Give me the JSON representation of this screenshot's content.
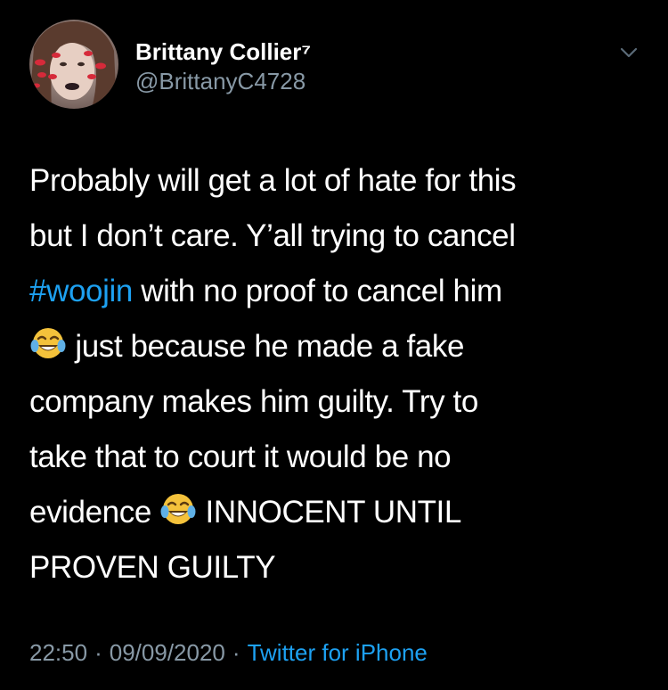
{
  "author": {
    "display_name": "Brittany Collier⁷",
    "handle": "@BrittanyC4728"
  },
  "icons": {
    "avatar": "profile-photo",
    "menu": "chevron-down-icon",
    "emoji": "face-with-tears-of-joy-emoji"
  },
  "tweet": {
    "line1": "Probably will get a lot of hate for this",
    "line2": "but I don’t care. Y’all trying to cancel",
    "hashtag": "#woojin",
    "line3_rest": " with no proof to cancel him",
    "line4_rest": " just because he made a fake",
    "line5": "company makes him guilty. Try to",
    "line6": "take that to court it would be no",
    "line7_start": "evidence ",
    "line7_rest": " INNOCENT UNTIL",
    "line8": "PROVEN GUILTY"
  },
  "meta": {
    "time": "22:50",
    "separator": "·",
    "date": "09/09/2020",
    "source": "Twitter for iPhone"
  },
  "colors": {
    "background": "#000000",
    "text": "#ffffff",
    "secondary": "#8899a6",
    "link": "#1da1f2"
  }
}
